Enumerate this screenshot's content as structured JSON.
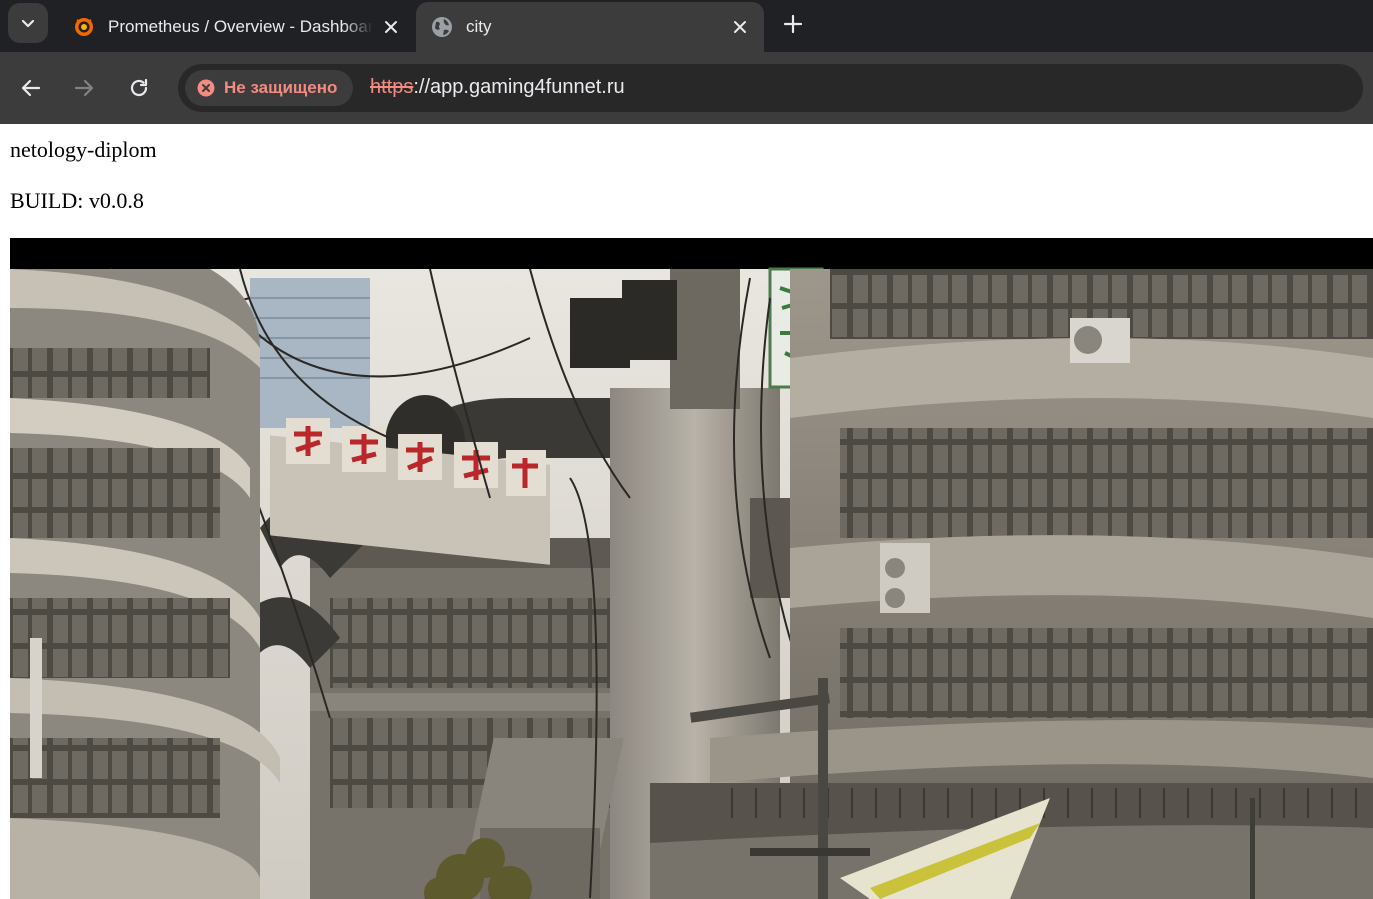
{
  "browser": {
    "tabs": [
      {
        "title": "Prometheus / Overview - Dashboard",
        "favicon": "grafana-icon",
        "active": false
      },
      {
        "title": "city",
        "favicon": "globe-icon",
        "active": true
      }
    ],
    "security_label": "Не защищено",
    "url_scheme": "https",
    "url_rest": "://app.gaming4funnet.ru"
  },
  "page": {
    "heading": "netology-diplom",
    "build_label": "BUILD: v0.0.8",
    "hero_image": "city-street-render"
  },
  "colors": {
    "tabstrip": "#202124",
    "toolbar": "#3c3c3c",
    "omnibox": "#282828",
    "warning": "#f28b82"
  }
}
